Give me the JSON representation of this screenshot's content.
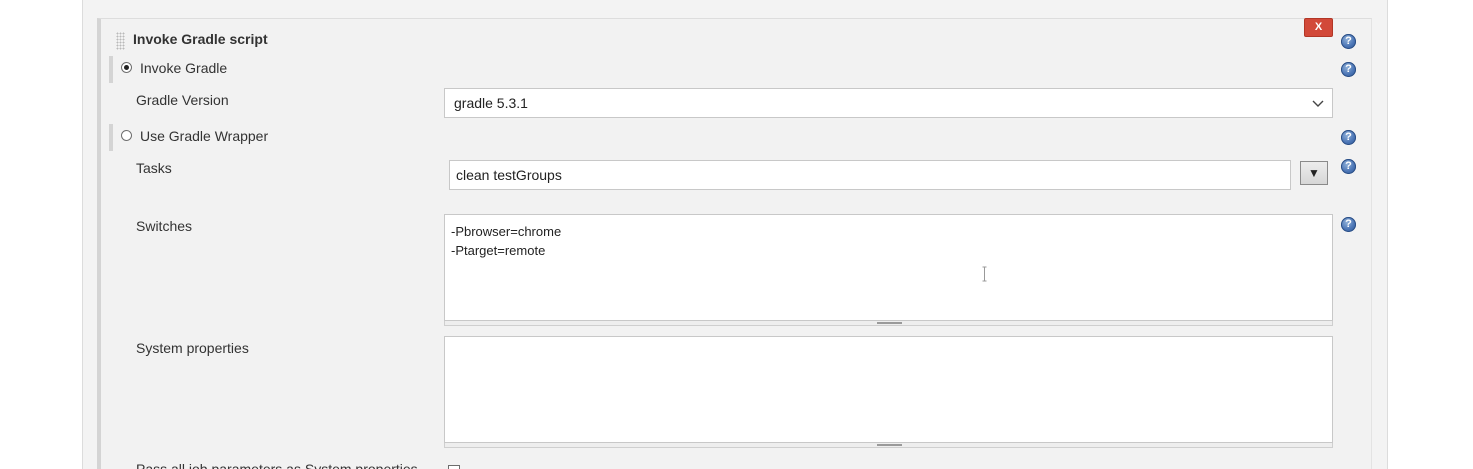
{
  "section": {
    "title": "Invoke Gradle script",
    "delete_label": "X"
  },
  "help_icon_glyph": "?",
  "options": {
    "invoke_gradle": {
      "label": "Invoke Gradle",
      "selected": true
    },
    "use_wrapper": {
      "label": "Use Gradle Wrapper",
      "selected": false
    }
  },
  "fields": {
    "gradle_version": {
      "label": "Gradle Version",
      "value": "gradle 5.3.1"
    },
    "tasks": {
      "label": "Tasks",
      "value": "clean testGroups",
      "dropdown_glyph": "▼"
    },
    "switches": {
      "label": "Switches",
      "value": "-Pbrowser=chrome\n-Ptarget=remote"
    },
    "system_properties": {
      "label": "System properties",
      "value": ""
    },
    "pass_job_params": {
      "label": "Pass all job parameters as System properties",
      "checked": false
    }
  },
  "colors": {
    "delete_button": "#d24939",
    "help_icon": "#4a74b5",
    "panel_background": "#f3f3f3"
  },
  "icons": {
    "help": "help-icon",
    "select_chevron": "chevron-down-icon",
    "drag": "drag-handle-icon"
  }
}
